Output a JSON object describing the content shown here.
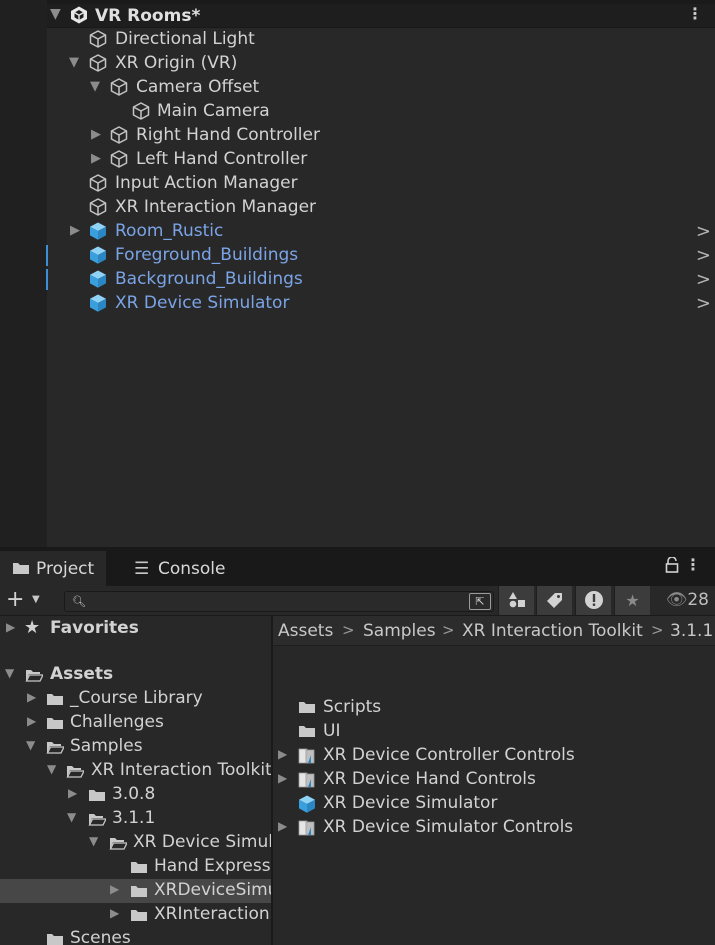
{
  "hierarchy": {
    "scene": {
      "title": "VR Rooms*"
    },
    "items": [
      {
        "label": "Directional Light"
      },
      {
        "label": "XR Origin (VR)"
      },
      {
        "label": "Camera Offset"
      },
      {
        "label": "Main Camera"
      },
      {
        "label": "Right Hand Controller"
      },
      {
        "label": "Left Hand Controller"
      },
      {
        "label": "Input Action Manager"
      },
      {
        "label": "XR Interaction Manager"
      },
      {
        "label": "Room_Rustic"
      },
      {
        "label": "Foreground_Buildings"
      },
      {
        "label": "Background_Buildings"
      },
      {
        "label": "XR Device Simulator"
      }
    ]
  },
  "project": {
    "tabs": [
      {
        "label": "Project",
        "icon": "folder-icon"
      },
      {
        "label": "Console",
        "icon": "console-icon"
      }
    ],
    "toolbar": {
      "search_placeholder": "",
      "hidden_count": "28"
    },
    "tree": [
      {
        "label": "Favorites"
      },
      {
        "label": "Assets"
      },
      {
        "label": "_Course Library"
      },
      {
        "label": "Challenges"
      },
      {
        "label": "Samples"
      },
      {
        "label": "XR Interaction Toolkit"
      },
      {
        "label": "3.0.8"
      },
      {
        "label": "3.1.1"
      },
      {
        "label": "XR Device Simul"
      },
      {
        "label": "Hand Express"
      },
      {
        "label": "XRDeviceSimu"
      },
      {
        "label": "XRInteractionS"
      },
      {
        "label": "Scenes"
      }
    ],
    "breadcrumb": [
      "Assets",
      "Samples",
      "XR Interaction Toolkit",
      "3.1.1"
    ],
    "assets": [
      {
        "label": "Scripts"
      },
      {
        "label": "UI"
      },
      {
        "label": "XR Device Controller Controls"
      },
      {
        "label": "XR Device Hand Controls"
      },
      {
        "label": "XR Device Simulator"
      },
      {
        "label": "XR Device Simulator Controls"
      }
    ]
  },
  "colors": {
    "prefab_text": "#7ba4e6",
    "panel_bg": "#282828",
    "selection": "#474747",
    "accent_marker": "#3d8fd8"
  }
}
